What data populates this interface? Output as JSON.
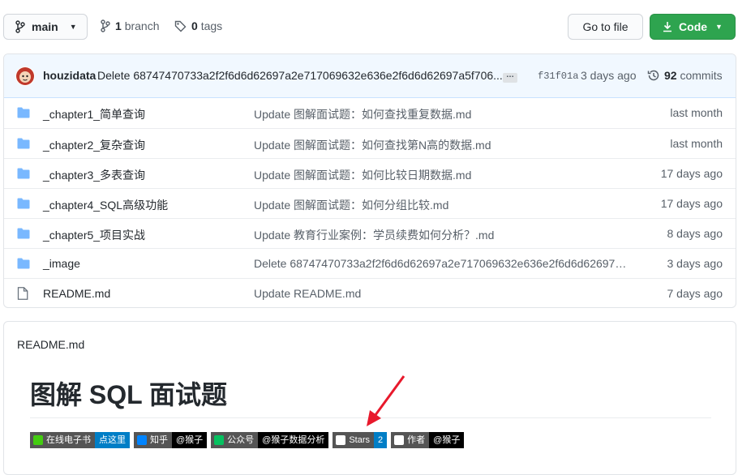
{
  "topbar": {
    "branch_name": "main",
    "branch_count": "1",
    "branch_label": "branch",
    "tag_count": "0",
    "tag_label": "tags",
    "go_to_file_label": "Go to file",
    "code_label": "Code"
  },
  "commit": {
    "author": "houzidata",
    "message": "Delete 68747470733a2f2f6d6d62697a2e717069632e636e2f6d6d62697a5f706...",
    "sha": "f31f01a",
    "time": "3 days ago",
    "commit_count": "92",
    "commit_label": "commits"
  },
  "files": [
    {
      "type": "folder",
      "name": "_chapter1_简单查询",
      "message": "Update 图解面试题：如何查找重复数据.md",
      "age": "last month"
    },
    {
      "type": "folder",
      "name": "_chapter2_复杂查询",
      "message": "Update 图解面试题：如何查找第N高的数据.md",
      "age": "last month"
    },
    {
      "type": "folder",
      "name": "_chapter3_多表查询",
      "message": "Update 图解面试题：如何比较日期数据.md",
      "age": "17 days ago"
    },
    {
      "type": "folder",
      "name": "_chapter4_SQL高级功能",
      "message": "Update 图解面试题：如何分组比较.md",
      "age": "17 days ago"
    },
    {
      "type": "folder",
      "name": "_chapter5_项目实战",
      "message": "Update 教育行业案例：学员续费如何分析？.md",
      "age": "8 days ago"
    },
    {
      "type": "folder",
      "name": "_image",
      "message": "Delete 68747470733a2f2f6d6d62697a2e717069632e636e2f6d6d62697a5...",
      "age": "3 days ago"
    },
    {
      "type": "file",
      "name": "README.md",
      "message": "Update README.md",
      "age": "7 days ago"
    }
  ],
  "readme": {
    "header": "README.md",
    "title": "图解 SQL 面试题",
    "badges": [
      {
        "left": "在线电子书",
        "right": "点这里",
        "color": "#007ec6",
        "icon_color": "#4c1"
      },
      {
        "left": "知乎",
        "right": "@猴子",
        "color": "#000000",
        "icon_color": "#0084ff"
      },
      {
        "left": "公众号",
        "right": "@猴子数据分析",
        "color": "#000000",
        "icon_color": "#07c160"
      },
      {
        "left": "Stars",
        "right": "2",
        "color": "#007ec6",
        "icon_color": "#ffffff"
      },
      {
        "left": "作者",
        "right": "@猴子",
        "color": "#000000",
        "icon_color": "#ffffff"
      }
    ]
  },
  "colors": {
    "accent_green": "#2ea44f",
    "folder_blue": "#79b8ff",
    "annotation_red": "#e8192c"
  }
}
